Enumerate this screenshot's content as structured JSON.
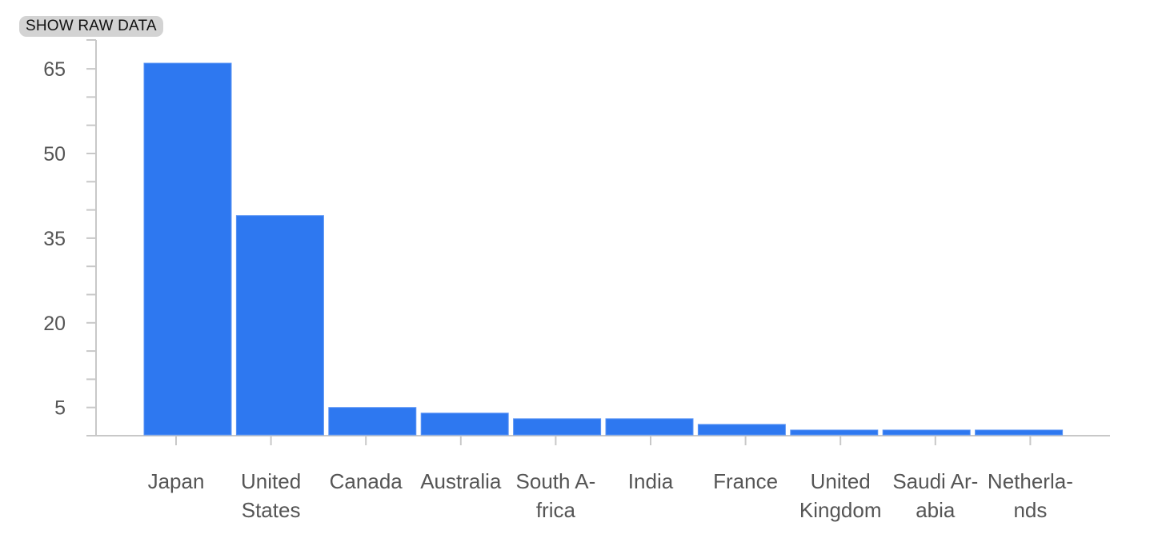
{
  "toolbar": {
    "show_raw_data_label": "SHOW RAW DATA"
  },
  "colors": {
    "bar": "#2e78f0",
    "axis": "#c8c8c8",
    "text": "#555555"
  },
  "chart_data": {
    "type": "bar",
    "title": "",
    "xlabel": "",
    "ylabel": "",
    "categories": [
      "Japan",
      "United States",
      "Canada",
      "Australia",
      "South Africa",
      "India",
      "France",
      "United Kingdom",
      "Saudi Arabia",
      "Netherlands"
    ],
    "category_label_lines": [
      [
        "Japan"
      ],
      [
        "United",
        "States"
      ],
      [
        "Canada"
      ],
      [
        "Australia"
      ],
      [
        "South A-",
        "frica"
      ],
      [
        "India"
      ],
      [
        "France"
      ],
      [
        "United",
        "Kingdom"
      ],
      [
        "Saudi Ar-",
        "abia"
      ],
      [
        "Netherla-",
        "nds"
      ]
    ],
    "values": [
      66,
      39,
      5,
      4,
      3,
      3,
      2,
      1,
      1,
      1
    ],
    "ylim": [
      0,
      70
    ],
    "yticks_major": [
      5,
      20,
      35,
      50,
      65
    ],
    "yticks_minor_step": 5,
    "grid": false,
    "legend": "none"
  }
}
